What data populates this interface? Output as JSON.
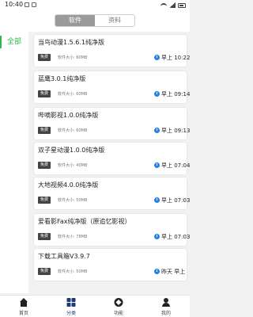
{
  "status_bar": {
    "time": "10:40"
  },
  "header": {
    "tabs": [
      {
        "label": "软件",
        "active": true
      },
      {
        "label": "资料",
        "active": false
      }
    ]
  },
  "sidebar": {
    "items": [
      {
        "label": "全部",
        "active": true
      }
    ]
  },
  "apps": [
    {
      "title": "当鸟动漫1.5.6.1纯净版",
      "badge": "免费",
      "size": "软件大小: 60MB",
      "time": "早上 10:22"
    },
    {
      "title": "蓝鹰3.0.1纯净版",
      "badge": "免费",
      "size": "软件大小: 60MB",
      "time": "早上 09:14"
    },
    {
      "title": "哔嘀影视1.0.0纯净版",
      "badge": "免费",
      "size": "软件大小: 60MB",
      "time": "早上 09:13"
    },
    {
      "title": "双子星动漫1.0.0纯净版",
      "badge": "免费",
      "size": "软件大小: 40MB",
      "time": "早上 07:04"
    },
    {
      "title": "大地视频4.0.0纯净版",
      "badge": "免费",
      "size": "软件大小: 50MB",
      "time": "早上 07:03"
    },
    {
      "title": "爱看影Fax纯净版（原追忆影视）",
      "badge": "免费",
      "size": "软件大小: 78MB",
      "time": "早上 07:03"
    },
    {
      "title": "下载工具箱V3.9.7",
      "badge": "免费",
      "size": "软件大小: 50MB",
      "time": "昨天 早上"
    }
  ],
  "bottom_nav": [
    {
      "label": "首页",
      "icon": "home-icon"
    },
    {
      "label": "分类",
      "icon": "category-grid-icon",
      "active": true
    },
    {
      "label": "功能",
      "icon": "compass-icon"
    },
    {
      "label": "我的",
      "icon": "user-icon"
    }
  ],
  "colors": {
    "accent_green": "#2db84d",
    "clock_blue": "#2680eb",
    "nav_active": "#1e3a78"
  }
}
